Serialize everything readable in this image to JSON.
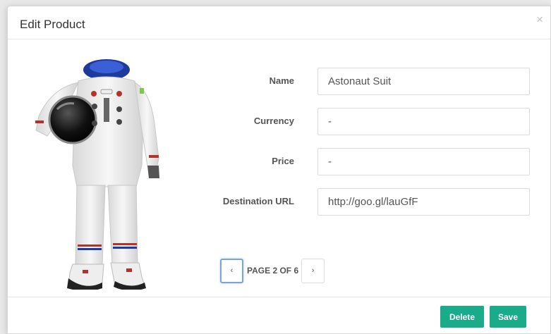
{
  "modal": {
    "title": "Edit Product",
    "close_symbol": "×"
  },
  "image": {
    "icon": "astronaut-suit-product-image"
  },
  "form": {
    "name": {
      "label": "Name",
      "value": "Astonaut Suit"
    },
    "currency": {
      "label": "Currency",
      "value": "-"
    },
    "price": {
      "label": "Price",
      "value": "-"
    },
    "destination_url": {
      "label": "Destination URL",
      "value": "http://goo.gl/lauGfF"
    }
  },
  "pager": {
    "prev_symbol": "‹",
    "next_symbol": "›",
    "text": "PAGE 2 OF 6",
    "current_page": 2,
    "total_pages": 6
  },
  "footer": {
    "delete_label": "Delete",
    "save_label": "Save"
  },
  "colors": {
    "button_green": "#1aab8a",
    "focus_blue": "#7da4d8"
  }
}
